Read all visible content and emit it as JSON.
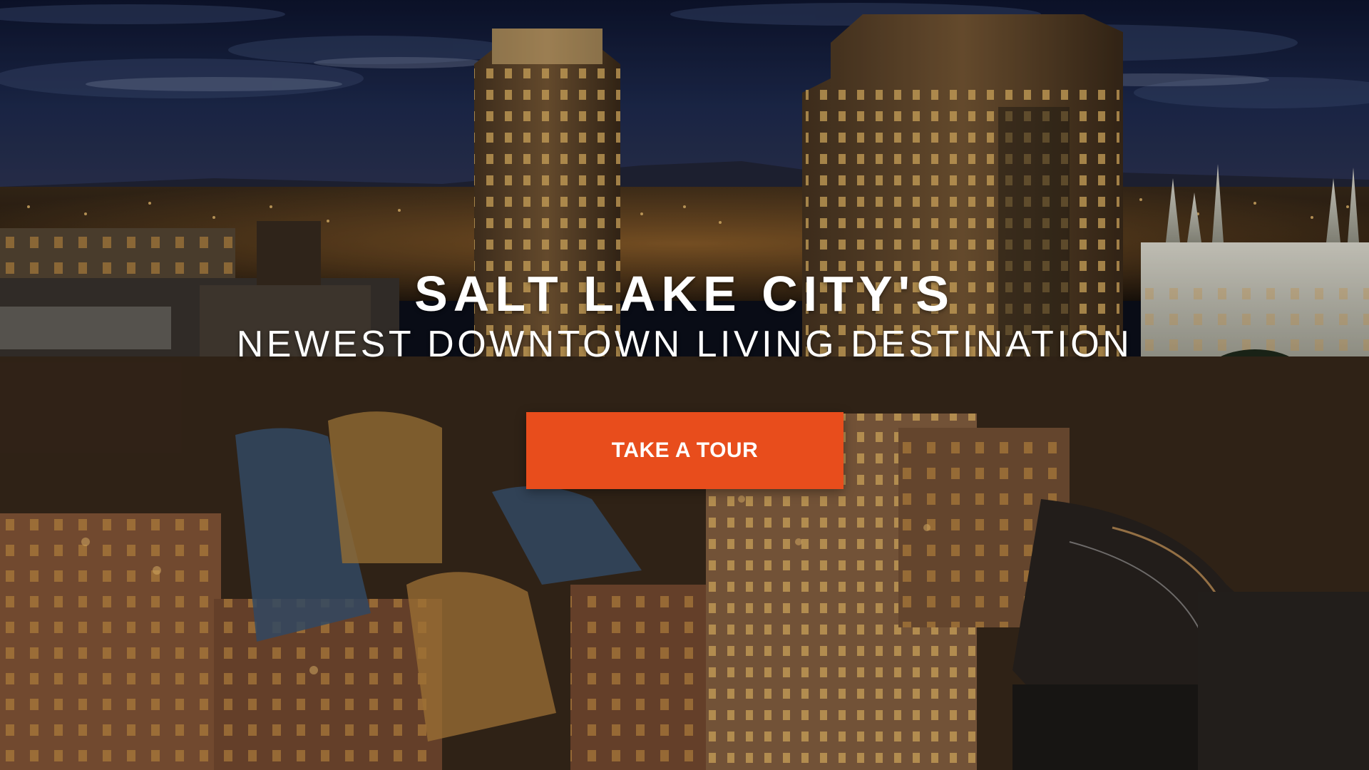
{
  "hero": {
    "title": "SALT LAKE CITY'S",
    "subtitle": "NEWEST DOWNTOWN LIVING DESTINATION",
    "cta_label": "TAKE A TOUR"
  },
  "colors": {
    "cta_background": "#e84d1c",
    "text": "#ffffff",
    "night_sky": "#1a2544"
  }
}
